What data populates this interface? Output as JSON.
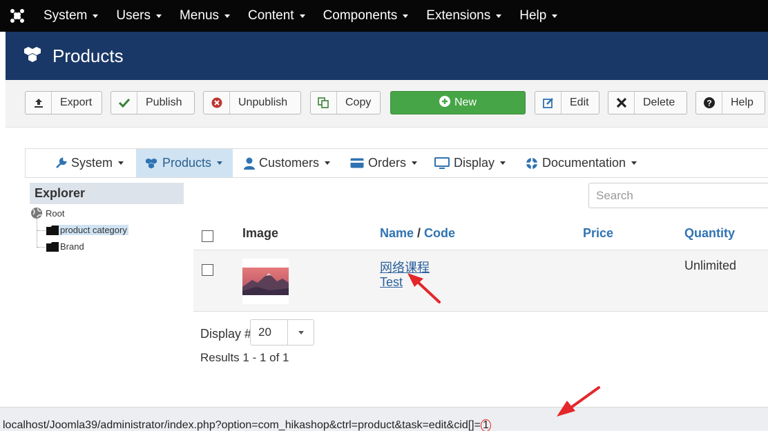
{
  "colors": {
    "topbar": "#070707",
    "titlebar": "#1a3867",
    "new_button": "#46a546",
    "link": "#2f73b2",
    "active_tab": "#cfe3f3",
    "annotation": "#e3272a"
  },
  "topbar": {
    "logo_icon": "joomla-logo-icon",
    "menu": [
      {
        "label": "System"
      },
      {
        "label": "Users"
      },
      {
        "label": "Menus"
      },
      {
        "label": "Content"
      },
      {
        "label": "Components"
      },
      {
        "label": "Extensions"
      },
      {
        "label": "Help"
      }
    ]
  },
  "header": {
    "icon": "cubes-icon",
    "title": "Products"
  },
  "toolbar": {
    "export": "Export",
    "publish": "Publish",
    "unpublish": "Unpublish",
    "copy": "Copy",
    "new": "New",
    "edit": "Edit",
    "delete": "Delete",
    "help": "Help"
  },
  "subnav": {
    "items": [
      {
        "label": "System",
        "icon": "wrench-icon"
      },
      {
        "label": "Products",
        "icon": "cubes-icon",
        "active": true
      },
      {
        "label": "Customers",
        "icon": "user-icon"
      },
      {
        "label": "Orders",
        "icon": "credit-card-icon"
      },
      {
        "label": "Display",
        "icon": "monitor-icon"
      },
      {
        "label": "Documentation",
        "icon": "lifebuoy-icon"
      }
    ]
  },
  "explorer": {
    "title": "Explorer",
    "root": "Root",
    "children": [
      "product category",
      "Brand"
    ],
    "selected": "product category"
  },
  "search": {
    "placeholder": "Search"
  },
  "table": {
    "headers": {
      "image": "Image",
      "name": "Name",
      "separator": " / ",
      "code": "Code",
      "price": "Price",
      "quantity": "Quantity"
    },
    "rows": [
      {
        "name": "网络课程",
        "code": "Test",
        "price": "",
        "quantity": "Unlimited"
      }
    ]
  },
  "pagination": {
    "display_label": "Display #",
    "display_value": "20",
    "results": "Results 1 - 1 of 1"
  },
  "statusbar": {
    "url_prefix": "localhost/Joomla39/administrator/index.php?option=com_hikashop&ctrl=product&task=edit&cid[]=",
    "url_id": "1"
  }
}
